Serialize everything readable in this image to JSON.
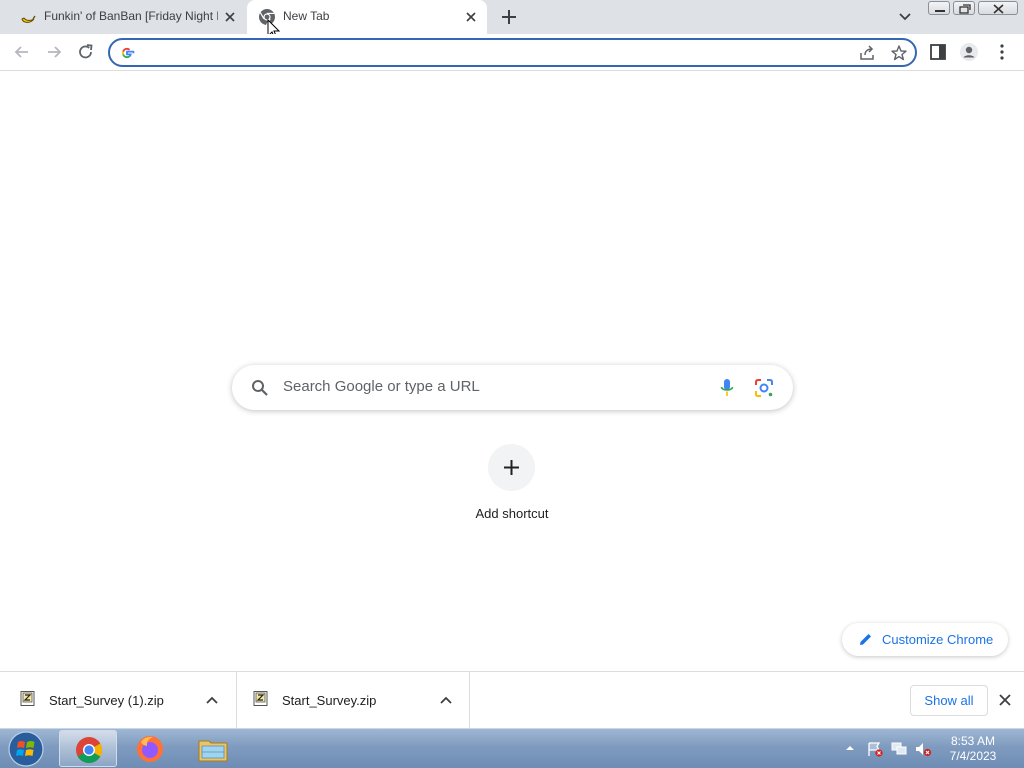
{
  "tabs": [
    {
      "title": "Funkin' of BanBan [Friday Night F",
      "icon": "banana-icon",
      "active": false
    },
    {
      "title": "New Tab",
      "icon": "chrome-icon",
      "active": true
    }
  ],
  "toolbar": {
    "address_value": "",
    "address_placeholder": ""
  },
  "ntp": {
    "search_placeholder": "Search Google or type a URL",
    "add_shortcut_label": "Add shortcut",
    "customize_label": "Customize Chrome"
  },
  "downloads": {
    "items": [
      {
        "filename": "Start_Survey (1).zip"
      },
      {
        "filename": "Start_Survey.zip"
      }
    ],
    "show_all_label": "Show all"
  },
  "taskbar": {
    "apps": [
      "windows-start-orb",
      "chrome-icon",
      "firefox-icon",
      "file-explorer-icon"
    ],
    "clock_time": "8:53 AM",
    "clock_date": "7/4/2023"
  },
  "colors": {
    "accent": "#1a73e8",
    "omnibox_border": "#3367b5",
    "tabstrip_bg": "#dee1e6"
  }
}
